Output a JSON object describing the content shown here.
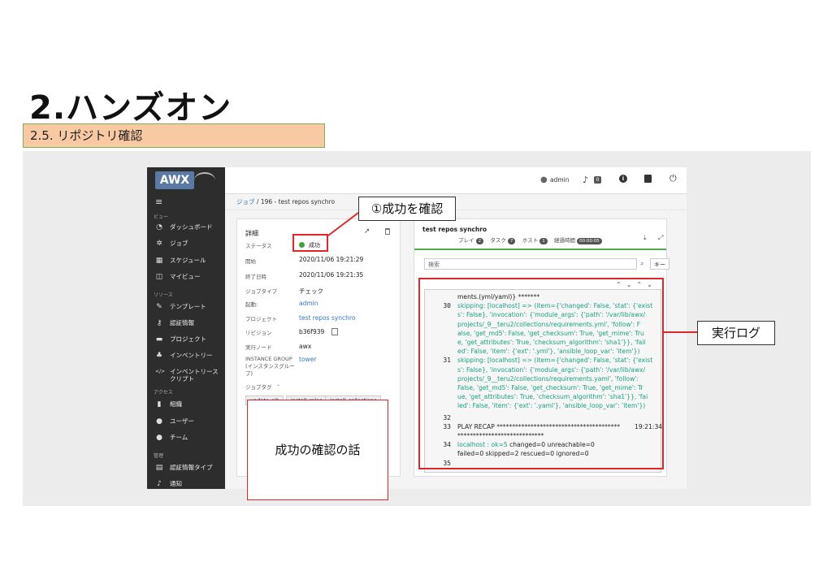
{
  "slide": {
    "title": "2.ハンズオン",
    "section": "2.5. リポジトリ確認"
  },
  "topbar": {
    "brand": "AWX",
    "user": "admin",
    "notif_count": "0"
  },
  "sidebar": {
    "groups": [
      {
        "label": "ビュー",
        "items": [
          {
            "label": "ダッシュボード",
            "icon": "dashboard-icon",
            "glyph": "◔"
          },
          {
            "label": "ジョブ",
            "icon": "spinner-icon",
            "glyph": "✲"
          },
          {
            "label": "スケジュール",
            "icon": "calendar-icon",
            "glyph": "▦"
          },
          {
            "label": "マイビュー",
            "icon": "columns-icon",
            "glyph": "◫"
          }
        ]
      },
      {
        "label": "リソース",
        "items": [
          {
            "label": "テンプレート",
            "icon": "edit-icon",
            "glyph": "✎"
          },
          {
            "label": "認証情報",
            "icon": "key-icon",
            "glyph": "⚷"
          },
          {
            "label": "プロジェクト",
            "icon": "folder-icon",
            "glyph": "▬"
          },
          {
            "label": "インベントリー",
            "icon": "sitemap-icon",
            "glyph": "♣"
          },
          {
            "label": "インベントリースクリプト",
            "icon": "code-icon",
            "glyph": "</>"
          }
        ]
      },
      {
        "label": "アクセス",
        "items": [
          {
            "label": "組織",
            "icon": "building-icon",
            "glyph": "▮"
          },
          {
            "label": "ユーザー",
            "icon": "user-icon",
            "glyph": "●"
          },
          {
            "label": "チーム",
            "icon": "users-icon",
            "glyph": "●"
          }
        ]
      },
      {
        "label": "管理",
        "items": [
          {
            "label": "認証情報タイプ",
            "icon": "list-icon",
            "glyph": "▤"
          },
          {
            "label": "通知",
            "icon": "bell-icon",
            "glyph": "♪"
          }
        ]
      }
    ]
  },
  "breadcrumb": {
    "root": "ジョブ",
    "sep": "/",
    "current": "196 - test repos synchro"
  },
  "details": {
    "heading": "詳細",
    "status_label": "ステータス",
    "status_value": "成功",
    "started_label": "開始",
    "started_value": "2020/11/06 19:21:29",
    "finished_label": "終了日時",
    "finished_value": "2020/11/06 19:21:35",
    "jobtype_label": "ジョブタイプ",
    "jobtype_value": "チェック",
    "launched_label": "起動:",
    "launched_value": "admin",
    "project_label": "プロジェクト",
    "project_value": "test repos synchro",
    "revision_label": "リビジョン",
    "revision_value": "b36f939",
    "node_label": "実行ノード",
    "node_value": "awx",
    "ig_label": "INSTANCE GROUP (インスタンスグループ)",
    "ig_value": "tower",
    "tags_label": "ジョブタグ",
    "tags": [
      "update_git",
      "install_roles",
      "install_collections"
    ]
  },
  "output": {
    "title": "test repos synchro",
    "play_label": "プレイ",
    "play_count": "2",
    "task_label": "タスク",
    "task_count": "7",
    "host_label": "ホスト",
    "host_count": "1",
    "elapsed_label": "経過時間",
    "elapsed_value": "00:00:05",
    "search_placeholder": "検索",
    "key_button": "キー",
    "log": [
      {
        "n": "",
        "t": "ments.(yml/yaml)} *******",
        "dark": true
      },
      {
        "n": "30",
        "t": "skipping: [localhost] => (item={'changed': False, 'stat': {'exist"
      },
      {
        "n": "",
        "t": "s': False}, 'invocation': {'module_args': {'path': '/var/lib/awx/"
      },
      {
        "n": "",
        "t": "projects/_9__teru2/collections/requirements.yml', 'follow': F"
      },
      {
        "n": "",
        "t": "alse, 'get_md5': False, 'get_checksum': True, 'get_mime': Tru"
      },
      {
        "n": "",
        "t": "e, 'get_attributes': True, 'checksum_algorithm': 'sha1'}}, 'fail"
      },
      {
        "n": "",
        "t": "ed': False, 'item': {'ext': '.yml'}, 'ansible_loop_var': 'item'})"
      },
      {
        "n": "31",
        "t": "skipping: [localhost] => (item={'changed': False, 'stat': {'exist"
      },
      {
        "n": "",
        "t": "s': False}, 'invocation': {'module_args': {'path': '/var/lib/awx/"
      },
      {
        "n": "",
        "t": "projects/_9__teru2/collections/requirements.yaml', 'follow':"
      },
      {
        "n": "",
        "t": "False, 'get_md5': False, 'get_checksum': True, 'get_mime': Tr"
      },
      {
        "n": "",
        "t": "ue, 'get_attributes': True, 'checksum_algorithm': 'sha1'}}, 'fai"
      },
      {
        "n": "",
        "t": "led': False, 'item': {'ext': '.yaml'}, 'ansible_loop_var': 'item'})"
      },
      {
        "n": "32",
        "t": ""
      },
      {
        "n": "33",
        "t": "PLAY RECAP ****************************************",
        "dark": true,
        "time": "19:21:34"
      },
      {
        "n": "",
        "t": "****************************",
        "dark": true
      },
      {
        "n": "34",
        "t": "localhost",
        "recap": true
      },
      {
        "n": "",
        "t": "failed=0    skipped=2    rescued=0    ignored=0",
        "dark": true
      },
      {
        "n": "35",
        "t": ""
      }
    ],
    "recap_ok": ": ok=5",
    "recap_changed": "changed=0",
    "recap_unreachable": "unreachable=0"
  },
  "annotations": {
    "success_callout": "①成功を確認",
    "log_callout": "実行ログ",
    "note_box": "成功の確認の話"
  },
  "colors": {
    "success": "#3aa53a",
    "annotation_red": "#e0262a",
    "section_bg": "#f9c9a3"
  }
}
